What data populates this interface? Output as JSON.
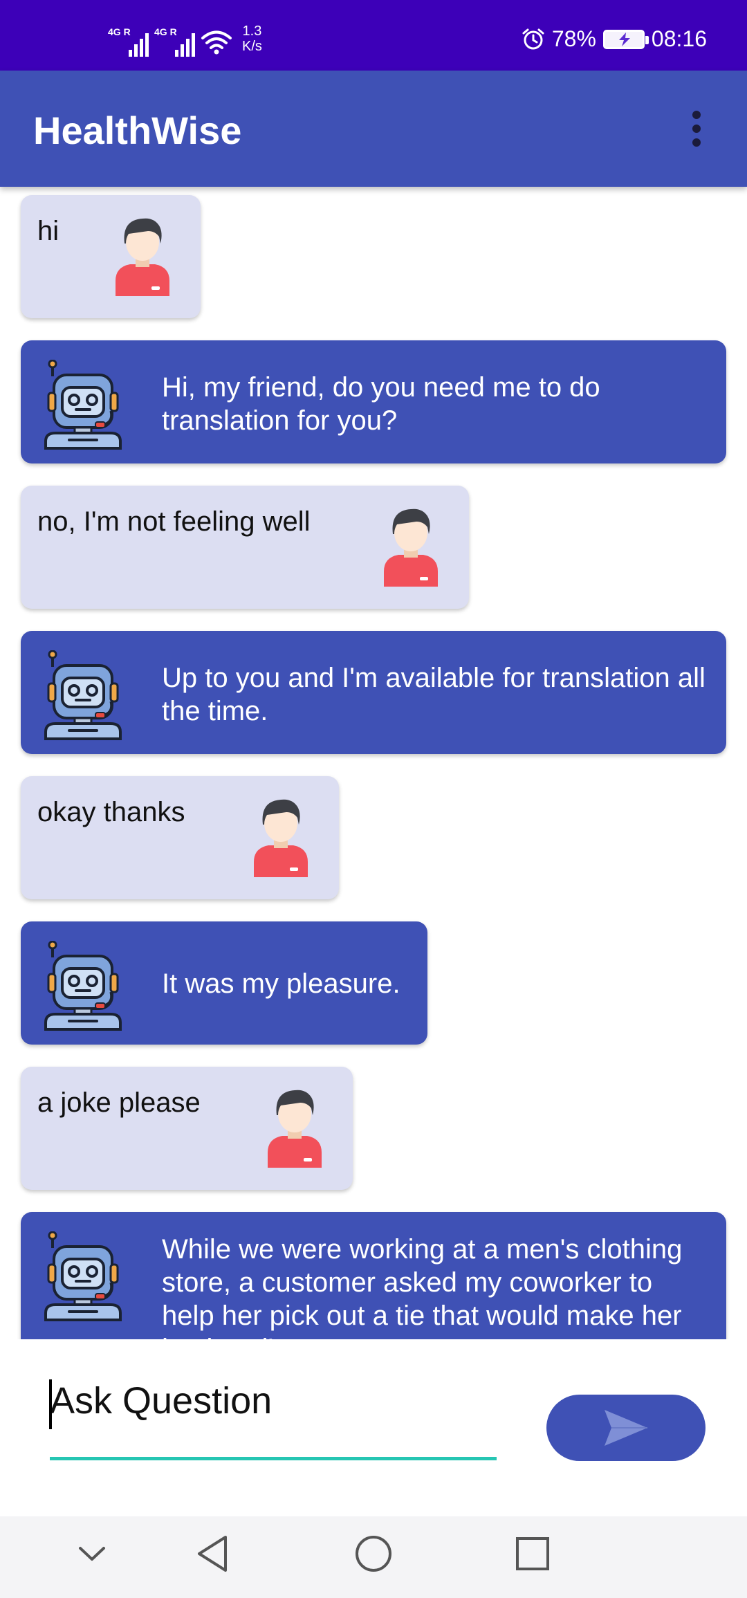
{
  "status_bar": {
    "signal1": "4G R",
    "signal2": "4G R",
    "speed_value": "1.3",
    "speed_unit": "K/s",
    "battery": "78%",
    "time": "08:16",
    "icons": [
      "signal-icon",
      "wifi-icon",
      "alarm-icon",
      "battery-icon"
    ]
  },
  "app_bar": {
    "title": "HealthWise",
    "menu_icon": "more-vert-icon"
  },
  "chat": {
    "messages": [
      {
        "sender": "user",
        "text": "hi",
        "avatar": "user-avatar-icon"
      },
      {
        "sender": "bot",
        "text": "Hi, my friend, do you need me to do translation for you?",
        "avatar": "robot-avatar-icon"
      },
      {
        "sender": "user",
        "text": "no, I'm not feeling well",
        "avatar": "user-avatar-icon"
      },
      {
        "sender": "bot",
        "text": "Up to you and I'm available for translation all the time.",
        "avatar": "robot-avatar-icon"
      },
      {
        "sender": "user",
        "text": "okay thanks",
        "avatar": "user-avatar-icon"
      },
      {
        "sender": "bot",
        "text": "It was my pleasure.",
        "avatar": "robot-avatar-icon"
      },
      {
        "sender": "user",
        "text": "a joke please",
        "avatar": "user-avatar-icon"
      },
      {
        "sender": "bot",
        "text": "While we were working at a men's clothing store, a customer asked my coworker to help her pick out a tie that would make her husband's ",
        "avatar": "robot-avatar-icon"
      }
    ]
  },
  "input": {
    "placeholder": "Ask Question",
    "value": "",
    "send_icon": "send-icon"
  },
  "colors": {
    "status_bar": "#3d00b8",
    "app_bar": "#3f51b5",
    "bot_bubble": "#3f51b5",
    "user_bubble": "#dcdef2",
    "input_underline": "#26c6b3"
  },
  "nav_bar": {
    "icons": [
      "chevron-down-icon",
      "back-icon",
      "home-icon",
      "recents-icon"
    ]
  }
}
